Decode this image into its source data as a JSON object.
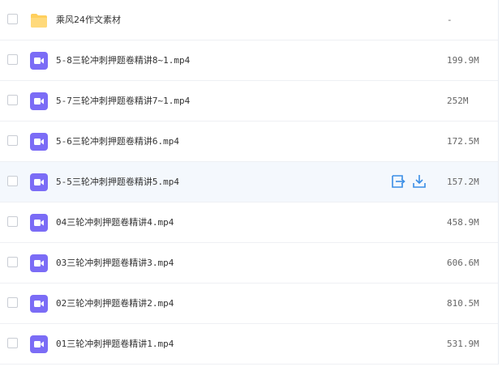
{
  "colors": {
    "folder": "#FFCF5C",
    "video": "#7B6CF6",
    "action": "#3A8EE6",
    "hover_row": "#F4F8FD"
  },
  "icons": {
    "folder": "folder-icon",
    "video": "video-file-icon",
    "move": "move-to-icon",
    "download": "download-icon"
  },
  "files": [
    {
      "name": "乘风24作文素材",
      "size": "-",
      "type": "folder"
    },
    {
      "name": "5-8三轮冲刺押题卷精讲8~1.mp4",
      "size": "199.9M",
      "type": "video"
    },
    {
      "name": "5-7三轮冲刺押题卷精讲7~1.mp4",
      "size": "252M",
      "type": "video"
    },
    {
      "name": "5-6三轮冲刺押题卷精讲6.mp4",
      "size": "172.5M",
      "type": "video"
    },
    {
      "name": "5-5三轮冲刺押题卷精讲5.mp4",
      "size": "157.2M",
      "type": "video",
      "hover": true
    },
    {
      "name": "04三轮冲刺押题卷精讲4.mp4",
      "size": "458.9M",
      "type": "video"
    },
    {
      "name": "03三轮冲刺押题卷精讲3.mp4",
      "size": "606.6M",
      "type": "video"
    },
    {
      "name": "02三轮冲刺押题卷精讲2.mp4",
      "size": "810.5M",
      "type": "video"
    },
    {
      "name": "01三轮冲刺押题卷精讲1.mp4",
      "size": "531.9M",
      "type": "video"
    }
  ]
}
